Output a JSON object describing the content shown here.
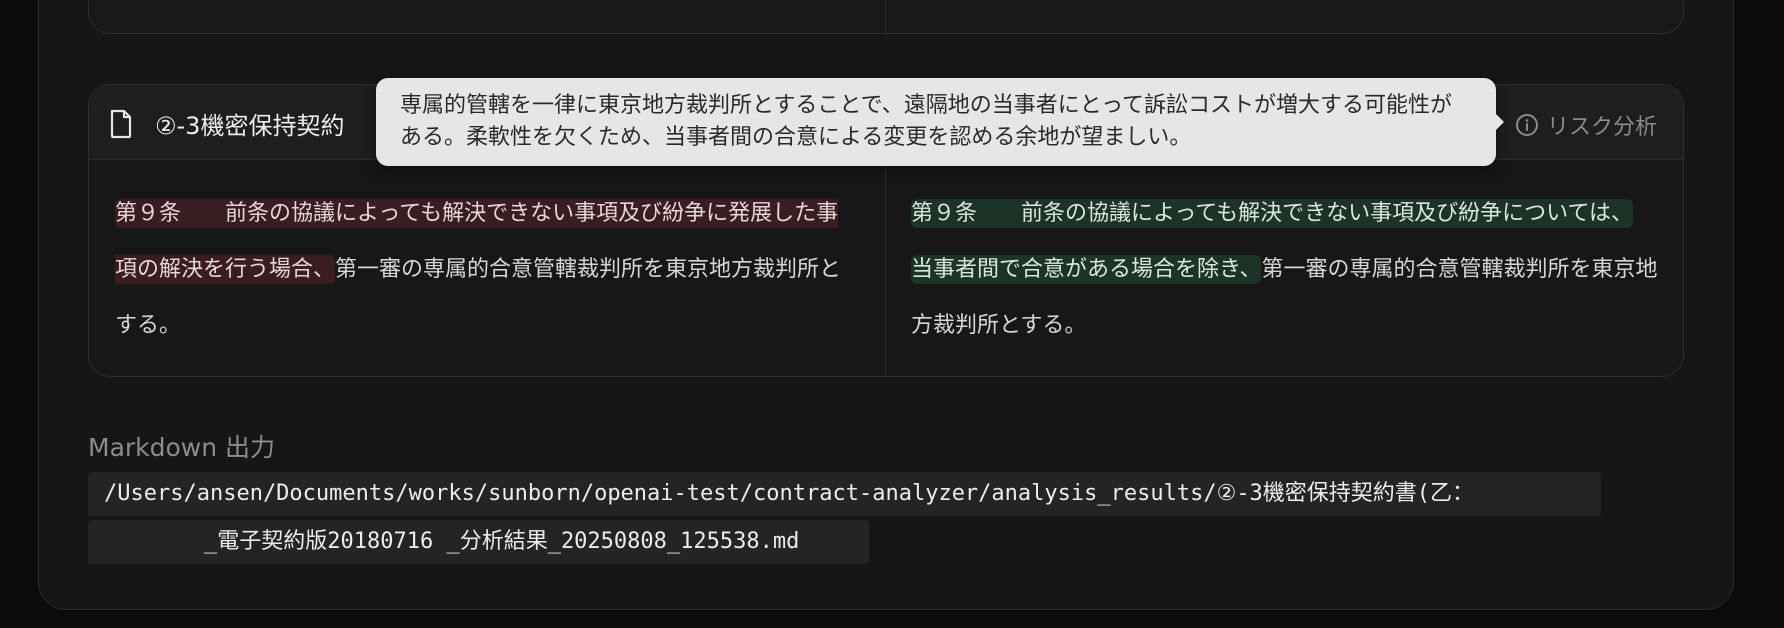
{
  "card": {
    "title": "②-3機密保持契約",
    "risk_button_label": "リスク分析"
  },
  "tooltip": {
    "text": "専属的管轄を一律に東京地方裁判所とすることで、遠隔地の当事者にとって訴訟コストが増大する可能性がある。柔軟性を欠くため、当事者間の合意による変更を認める余地が望ましい。"
  },
  "clauses": {
    "original": {
      "deleted": "第９条　　前条の協議によっても解決できない事項及び紛争に発展した事項の解決を行う場合、",
      "rest": "第一審の専属的合意管轄裁判所を東京地方裁判所とする。"
    },
    "revised": {
      "added_1": "第９条　　前条の協議によっても解決できない事項及び紛争については、",
      "added_2": "当事者間で合意がある場合を除き、",
      "rest": "第一審の専属的合意管轄裁判所を東京地方裁判所とする。"
    }
  },
  "markdown_output": {
    "label": "Markdown 出力",
    "path_line_1": "/Users/ansen/Documents/works/sunborn/openai-test/contract-analyzer/analysis_results/②-3機密保持契約書(乙：",
    "path_line_2": "_電子契約版20180716 _分析結果_20250808_125538.md"
  },
  "colors": {
    "deleted_highlight": "#3a1d22",
    "added_highlight": "#1c3327",
    "tooltip_bg": "#e6e6e6"
  },
  "icons": {
    "document": "document-icon",
    "info": "info-circle-icon"
  }
}
